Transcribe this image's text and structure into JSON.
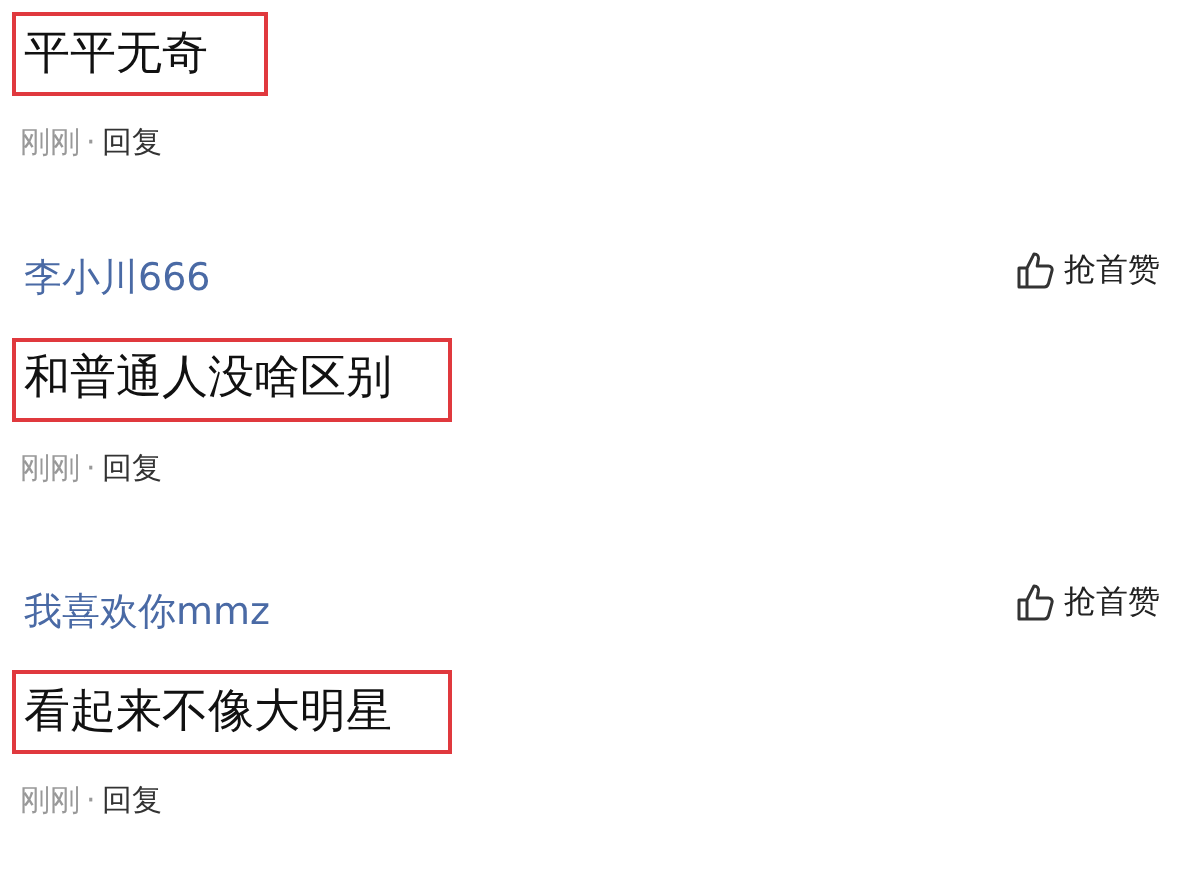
{
  "comments": [
    {
      "text": "平平无奇",
      "highlighted": true,
      "time": "刚刚",
      "separator": "·",
      "reply": "回复"
    },
    {
      "author": "李小川666",
      "like": "抢首赞",
      "text": "和普通人没啥区别",
      "highlighted": true,
      "time": "刚刚",
      "separator": "·",
      "reply": "回复"
    },
    {
      "author": "我喜欢你mmz",
      "like": "抢首赞",
      "text": "看起来不像大明星",
      "highlighted": true,
      "time": "刚刚",
      "separator": "·",
      "reply": "回复"
    }
  ]
}
